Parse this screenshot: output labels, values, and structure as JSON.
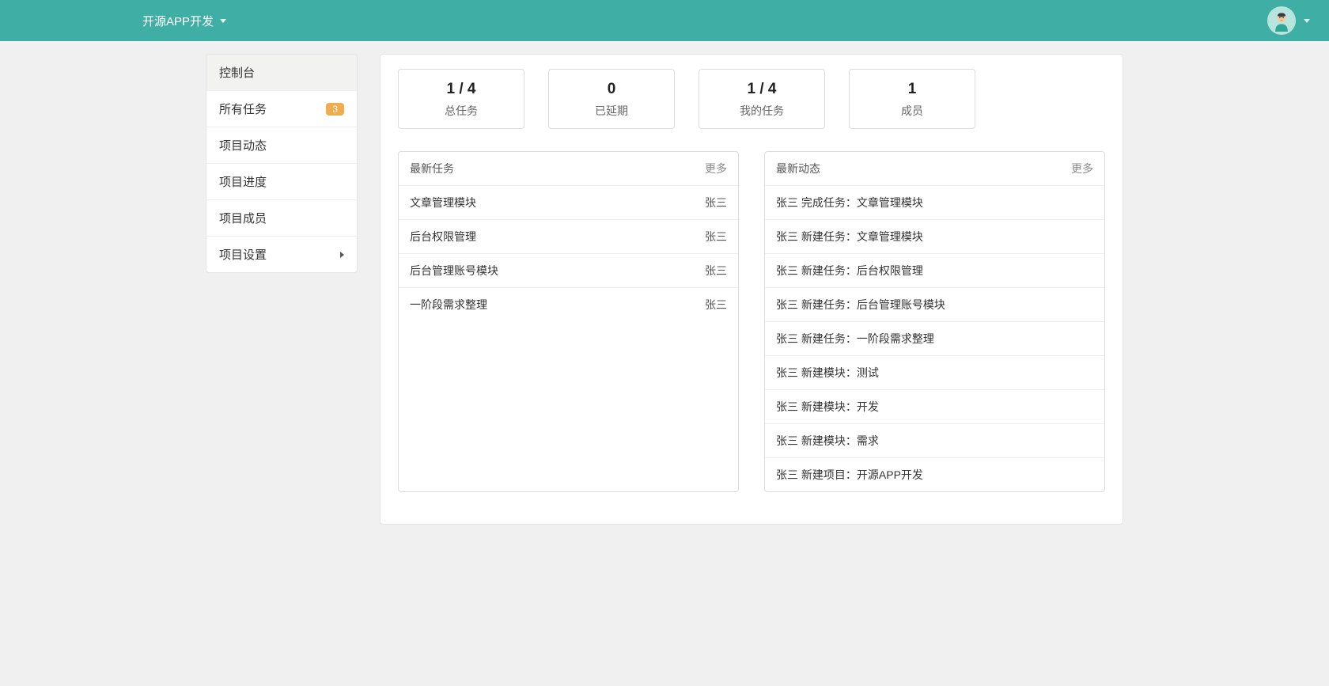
{
  "header": {
    "project_name": "开源APP开发"
  },
  "sidebar": {
    "items": [
      {
        "label": "控制台",
        "active": true
      },
      {
        "label": "所有任务",
        "badge": "3"
      },
      {
        "label": "项目动态"
      },
      {
        "label": "项目进度"
      },
      {
        "label": "项目成员"
      },
      {
        "label": "项目设置",
        "has_submenu": true
      }
    ]
  },
  "stats": [
    {
      "value": "1 / 4",
      "label": "总任务"
    },
    {
      "value": "0",
      "label": "已延期"
    },
    {
      "value": "1 / 4",
      "label": "我的任务"
    },
    {
      "value": "1",
      "label": "成员"
    }
  ],
  "latest_tasks": {
    "title": "最新任务",
    "more_label": "更多",
    "rows": [
      {
        "title": "文章管理模块",
        "author": "张三"
      },
      {
        "title": "后台权限管理",
        "author": "张三"
      },
      {
        "title": "后台管理账号模块",
        "author": "张三"
      },
      {
        "title": "一阶段需求整理",
        "author": "张三"
      }
    ]
  },
  "latest_activity": {
    "title": "最新动态",
    "more_label": "更多",
    "rows": [
      {
        "text": "张三 完成任务：文章管理模块"
      },
      {
        "text": "张三 新建任务：文章管理模块"
      },
      {
        "text": "张三 新建任务：后台权限管理"
      },
      {
        "text": "张三 新建任务：后台管理账号模块"
      },
      {
        "text": "张三 新建任务：一阶段需求整理"
      },
      {
        "text": "张三 新建模块：测试"
      },
      {
        "text": "张三 新建模块：开发"
      },
      {
        "text": "张三 新建模块：需求"
      },
      {
        "text": "张三 新建项目：开源APP开发"
      }
    ]
  }
}
